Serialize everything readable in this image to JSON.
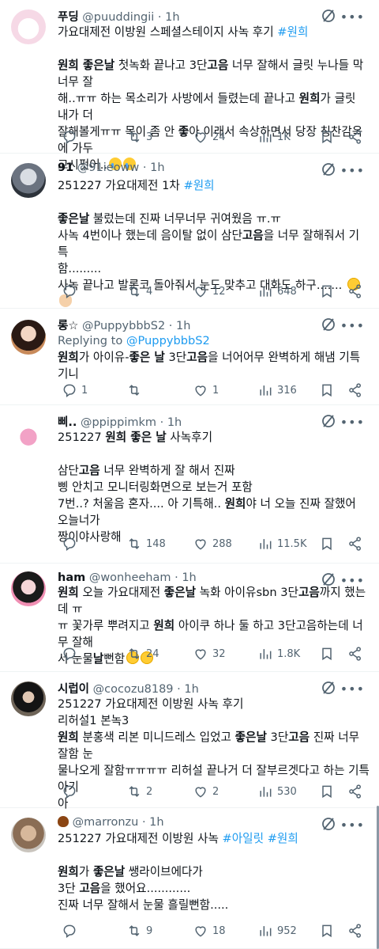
{
  "tweets": [
    {
      "name": "푸딩",
      "handle": "@puuddingii",
      "time": "1h",
      "avatar_icon": "cat-character-avatar",
      "lines": [
        [
          {
            "t": "가요대제전 이방원 스페셜스테이지 사녹 후기 "
          },
          {
            "t": "#원희",
            "c": "link"
          }
        ],
        [],
        [
          {
            "t": "원희 좋은날",
            "c": "b"
          },
          {
            "t": " 첫녹화 끝나고 3단"
          },
          {
            "t": "고음",
            "c": "b"
          },
          {
            "t": " 너무 잘해서 글릿 누나들 막 너무 잘"
          }
        ],
        [
          {
            "t": "해..ㅠㅠ 하는 목소리가 사방에서 들렸는데 끝나고 "
          },
          {
            "t": "원희",
            "c": "b"
          },
          {
            "t": "가 글릿 내가 더"
          }
        ],
        [
          {
            "t": "잘해볼게ㅠㅠ 목이 좀 안 "
          },
          {
            "t": "좋",
            "c": "b"
          },
          {
            "t": "아 이래서 속상하면서 당장 칭찬감옥에 가두"
          }
        ],
        [
          {
            "t": "고시펏어.."
          },
          {
            "e": "cry"
          },
          {
            "e": "cry"
          }
        ]
      ],
      "reply": "",
      "retweets": "3",
      "likes": "24",
      "views": "1K"
    },
    {
      "name": "91",
      "handle": "@91ieoww",
      "time": "1h",
      "avatar_icon": "anime-character-avatar",
      "lines": [
        [
          {
            "t": "251227 가요대제전 1차 "
          },
          {
            "t": "#원희",
            "c": "link"
          }
        ],
        [],
        [
          {
            "t": "좋은날",
            "c": "b"
          },
          {
            "t": " 불렀는데 진짜 너무너무 귀여웠음 ㅠ.ㅠ"
          }
        ],
        [
          {
            "t": "사녹 4번이나 했는데 음이탈 없이 삼단"
          },
          {
            "t": "고음",
            "c": "b"
          },
          {
            "t": "을 너무 잘해줘서 기특"
          }
        ],
        [
          {
            "t": "함........."
          }
        ],
        [
          {
            "t": "사녹 끝나고 발롯코 돌아줘서 눈도 맞추고 대화도 하구....... "
          },
          {
            "e": "plead"
          },
          {
            "e": "hand"
          }
        ]
      ],
      "reply": "",
      "retweets": "4",
      "likes": "12",
      "views": "648"
    },
    {
      "name": "롱☆",
      "handle": "@PuppybbbS2",
      "time": "1h",
      "avatar_icon": "profile-photo-avatar",
      "replying_label": "Replying to ",
      "replying_to": "@PuppybbbS2",
      "lines": [
        [
          {
            "t": "원희",
            "c": "b"
          },
          {
            "t": "가 아이유-"
          },
          {
            "t": "좋은 날",
            "c": "b"
          },
          {
            "t": " 3단"
          },
          {
            "t": "고음",
            "c": "b"
          },
          {
            "t": "을 너어어무 완벽하게 해냄 기특기니"
          }
        ]
      ],
      "reply": "1",
      "retweets": "",
      "likes": "1",
      "views": "316"
    },
    {
      "name": "삐..",
      "handle": "@ppippimkm",
      "time": "1h",
      "avatar_icon": "pink-octopus-avatar",
      "lines": [
        [
          {
            "t": "251227 "
          },
          {
            "t": "원희 좋은 날",
            "c": "b"
          },
          {
            "t": " 사녹후기"
          }
        ],
        [],
        [
          {
            "t": "삼단"
          },
          {
            "t": "고음",
            "c": "b"
          },
          {
            "t": " 너무 완벽하게 잘 해서 진짜"
          }
        ],
        [
          {
            "t": "삥 안치고 모니터링화면으로 보는거 포함"
          }
        ],
        [
          {
            "t": "7번..? 처울음 혼자.... 아 기특해.. "
          },
          {
            "t": "원희",
            "c": "b"
          },
          {
            "t": "야 너 오늘 진짜 잘했어 오늘너가"
          }
        ],
        [
          {
            "t": "짱이야사랑해"
          }
        ]
      ],
      "reply": "",
      "retweets": "148",
      "likes": "288",
      "views": "11.5K"
    },
    {
      "name": "ham",
      "handle": "@wonheeham",
      "time": "1h",
      "avatar_icon": "profile-photo-avatar",
      "lines": [
        [
          {
            "t": "원희",
            "c": "b"
          },
          {
            "t": " 오늘 가요대제전 "
          },
          {
            "t": "좋은날",
            "c": "b"
          },
          {
            "t": " 녹화 아이유sbn 3단"
          },
          {
            "t": "고음",
            "c": "b"
          },
          {
            "t": "까지 했는데 ㅠ"
          }
        ],
        [
          {
            "t": "ㅠ 꽃가루 뿌려지고 "
          },
          {
            "t": "원희",
            "c": "b"
          },
          {
            "t": " 아이쿠 하나 둘 하고 3단고음하는데 너무 잘해"
          }
        ],
        [
          {
            "t": "서 눈물"
          },
          {
            "t": "날",
            "c": "b"
          },
          {
            "t": "뻔함"
          },
          {
            "e": "plead"
          },
          {
            "e": "plead"
          }
        ]
      ],
      "reply": "",
      "retweets": "24",
      "likes": "32",
      "views": "1.8K"
    },
    {
      "name": "시럽이",
      "handle": "@cocozu8189",
      "time": "1h",
      "avatar_icon": "masked-person-avatar",
      "lines": [
        [
          {
            "t": "251227 가요대제전 이방원 사녹 후기"
          }
        ],
        [
          {
            "t": "리허설1 본녹3"
          }
        ],
        [
          {
            "t": "원희",
            "c": "b"
          },
          {
            "t": " 분홍색 리본 미니드레스 입었고 "
          },
          {
            "t": "좋은날",
            "c": "b"
          },
          {
            "t": " 3단"
          },
          {
            "t": "고음",
            "c": "b"
          },
          {
            "t": " 진짜 너무 잘함 눈"
          }
        ],
        [
          {
            "t": "물나오게 잘함ㅠㅠㅠㅠ 리허설 끝나거 더 잘부르겟다고 하는 기특아기"
          }
        ],
        [
          {
            "t": "아"
          }
        ]
      ],
      "reply": "",
      "retweets": "2",
      "likes": "2",
      "views": "530"
    },
    {
      "name": "",
      "handle": "@marronzu",
      "time": "1h",
      "avatar_icon": "profile-photo-avatar",
      "lines": [
        [
          {
            "t": "251227 가요대제전 이방원 사녹 "
          },
          {
            "t": "#아일릿",
            "c": "link"
          },
          {
            "t": " "
          },
          {
            "t": "#원희",
            "c": "link"
          }
        ],
        [],
        [
          {
            "t": "원희",
            "c": "b"
          },
          {
            "t": "가 "
          },
          {
            "t": "좋은날",
            "c": "b"
          },
          {
            "t": " 쌩라이브에다가"
          }
        ],
        [
          {
            "t": "3단 "
          },
          {
            "t": "고음",
            "c": "b"
          },
          {
            "t": "을 했어요............"
          }
        ],
        [
          {
            "t": "진짜 너무 잘해서 눈물 흘릴뻔함....."
          }
        ]
      ],
      "reply": "",
      "retweets": "9",
      "likes": "18",
      "views": "952"
    }
  ]
}
